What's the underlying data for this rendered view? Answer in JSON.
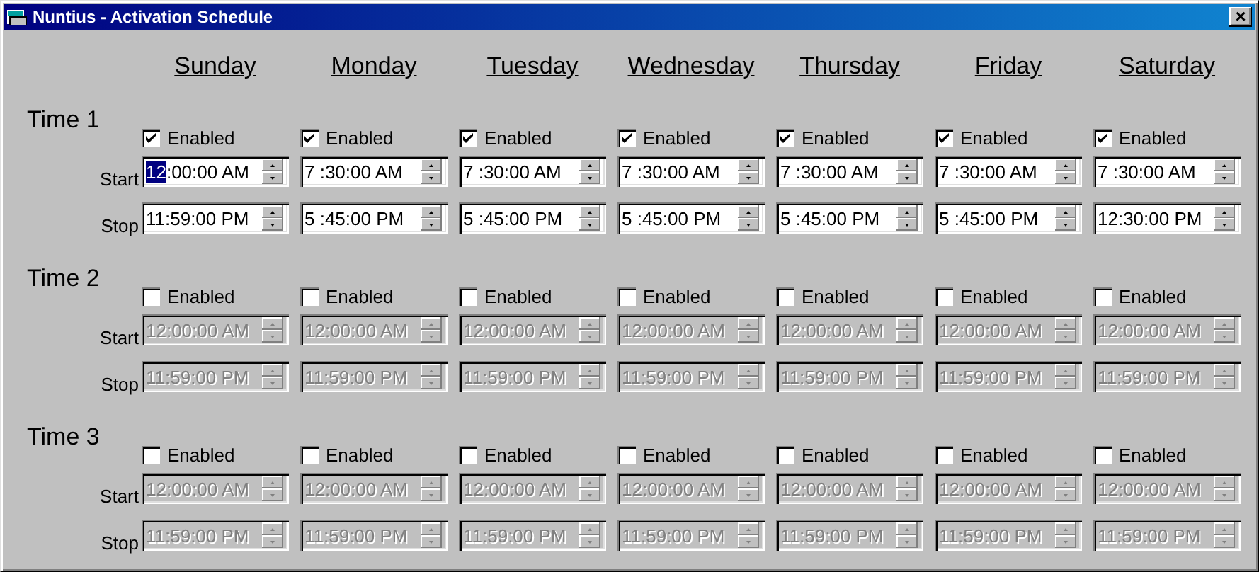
{
  "window": {
    "title": "Nuntius - Activation Schedule",
    "close": "×"
  },
  "days": [
    "Sunday",
    "Monday",
    "Tuesday",
    "Wednesday",
    "Thursday",
    "Friday",
    "Saturday"
  ],
  "schedules": [
    {
      "label": "Time 1",
      "start_label": "Start",
      "stop_label": "Stop",
      "days": [
        {
          "label": "Enabled",
          "checked": true,
          "disabled": false,
          "start_selection": "12",
          "start": ":00:00 AM",
          "stop": "11:59:00 PM"
        },
        {
          "label": "Enabled",
          "checked": true,
          "disabled": false,
          "start": "7 :30:00 AM",
          "stop": "5 :45:00 PM"
        },
        {
          "label": "Enabled",
          "checked": true,
          "disabled": false,
          "start": "7 :30:00 AM",
          "stop": "5 :45:00 PM"
        },
        {
          "label": "Enabled",
          "checked": true,
          "disabled": false,
          "start": "7 :30:00 AM",
          "stop": "5 :45:00 PM"
        },
        {
          "label": "Enabled",
          "checked": true,
          "disabled": false,
          "start": "7 :30:00 AM",
          "stop": "5 :45:00 PM"
        },
        {
          "label": "Enabled",
          "checked": true,
          "disabled": false,
          "start": "7 :30:00 AM",
          "stop": "5 :45:00 PM"
        },
        {
          "label": "Enabled",
          "checked": true,
          "disabled": false,
          "start": "7 :30:00 AM",
          "stop": "12:30:00 PM"
        }
      ]
    },
    {
      "label": "Time 2",
      "start_label": "Start",
      "stop_label": "Stop",
      "days": [
        {
          "label": "Enabled",
          "checked": false,
          "disabled": true,
          "start": "12:00:00 AM",
          "stop": "11:59:00 PM"
        },
        {
          "label": "Enabled",
          "checked": false,
          "disabled": true,
          "start": "12:00:00 AM",
          "stop": "11:59:00 PM"
        },
        {
          "label": "Enabled",
          "checked": false,
          "disabled": true,
          "start": "12:00:00 AM",
          "stop": "11:59:00 PM"
        },
        {
          "label": "Enabled",
          "checked": false,
          "disabled": true,
          "start": "12:00:00 AM",
          "stop": "11:59:00 PM"
        },
        {
          "label": "Enabled",
          "checked": false,
          "disabled": true,
          "start": "12:00:00 AM",
          "stop": "11:59:00 PM"
        },
        {
          "label": "Enabled",
          "checked": false,
          "disabled": true,
          "start": "12:00:00 AM",
          "stop": "11:59:00 PM"
        },
        {
          "label": "Enabled",
          "checked": false,
          "disabled": true,
          "start": "12:00:00 AM",
          "stop": "11:59:00 PM"
        }
      ]
    },
    {
      "label": "Time 3",
      "start_label": "Start",
      "stop_label": "Stop",
      "days": [
        {
          "label": "Enabled",
          "checked": false,
          "disabled": true,
          "start": "12:00:00 AM",
          "stop": "11:59:00 PM"
        },
        {
          "label": "Enabled",
          "checked": false,
          "disabled": true,
          "start": "12:00:00 AM",
          "stop": "11:59:00 PM"
        },
        {
          "label": "Enabled",
          "checked": false,
          "disabled": true,
          "start": "12:00:00 AM",
          "stop": "11:59:00 PM"
        },
        {
          "label": "Enabled",
          "checked": false,
          "disabled": true,
          "start": "12:00:00 AM",
          "stop": "11:59:00 PM"
        },
        {
          "label": "Enabled",
          "checked": false,
          "disabled": true,
          "start": "12:00:00 AM",
          "stop": "11:59:00 PM"
        },
        {
          "label": "Enabled",
          "checked": false,
          "disabled": true,
          "start": "12:00:00 AM",
          "stop": "11:59:00 PM"
        },
        {
          "label": "Enabled",
          "checked": false,
          "disabled": true,
          "start": "12:00:00 AM",
          "stop": "11:59:00 PM"
        }
      ]
    }
  ]
}
